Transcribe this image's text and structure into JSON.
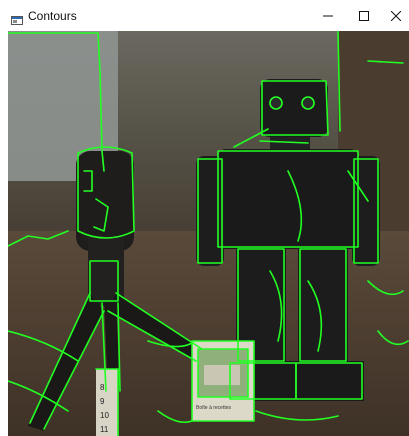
{
  "window": {
    "title": "Contours",
    "controls": {
      "minimize_icon": "minimize-icon",
      "maximize_icon": "maximize-icon",
      "close_icon": "close-icon"
    }
  },
  "image": {
    "contour_color": "#22ff22",
    "ruler_labels": [
      "8",
      "9",
      "10",
      "11"
    ],
    "box_text": "Boîte à recettes"
  }
}
